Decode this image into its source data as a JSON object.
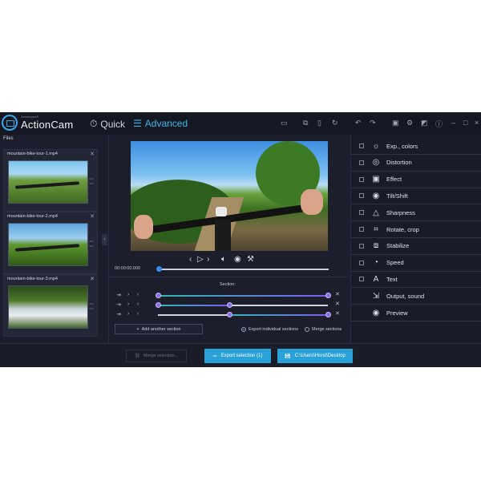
{
  "app": {
    "brand_small": "Ashampoo®",
    "brand": "ActionCam",
    "mode_quick": "Quick",
    "mode_advanced": "Advanced",
    "files_label": "Files"
  },
  "files": [
    {
      "name": "mountain-bike-tour-1.mp4"
    },
    {
      "name": "mountain-bike-tour-2.mp4"
    },
    {
      "name": "mountain-bike-tour-3.mp4"
    }
  ],
  "player": {
    "timecode": "00:00:00.000",
    "progress": 0.0
  },
  "sections": {
    "label": "Section:",
    "rows": [
      {
        "start": 0.0,
        "end": 1.0
      },
      {
        "start": 0.0,
        "end": 0.42
      },
      {
        "start": 0.42,
        "end": 1.0
      }
    ],
    "add_label": "Add another section",
    "export_individual": "Export individual sections",
    "merge_sections": "Merge sections"
  },
  "bottom": {
    "merge_selection": "Merge selection...",
    "export_selection": "Export selection (1)",
    "output_path": "C:\\Users\\Horst\\Desktop"
  },
  "panel": {
    "items": [
      {
        "label": "Exp., colors",
        "icon": "sun-icon"
      },
      {
        "label": "Distortion",
        "icon": "lens-icon"
      },
      {
        "label": "Effect",
        "icon": "effect-icon"
      },
      {
        "label": "Tilt/Shift",
        "icon": "tilt-shift-icon"
      },
      {
        "label": "Sharpness",
        "icon": "triangle-icon"
      },
      {
        "label": "Rotate, crop",
        "icon": "crop-icon"
      },
      {
        "label": "Stabilize",
        "icon": "stabilize-icon"
      },
      {
        "label": "Speed",
        "icon": "speed-icon"
      },
      {
        "label": "Text",
        "icon": "text-icon"
      },
      {
        "label": "Output, sound",
        "icon": "output-icon"
      },
      {
        "label": "Preview",
        "icon": "eye-icon"
      }
    ]
  },
  "colors": {
    "accent": "#2aa1d6",
    "section_purple": "#7b5cf0",
    "section_teal": "#2fb8b0",
    "app_bg": "#1c1f2b"
  }
}
